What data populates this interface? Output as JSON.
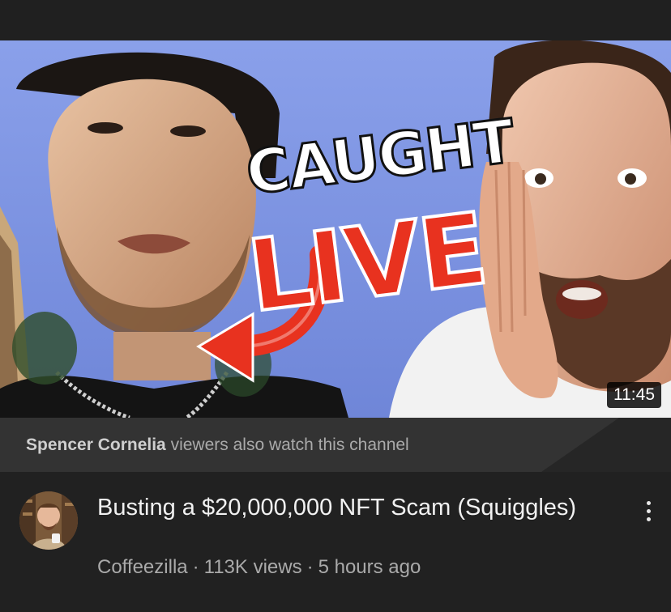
{
  "video": {
    "duration": "11:45",
    "thumbnail_text_top": "CAUGHT",
    "thumbnail_text_bottom": "LIVE",
    "title": "Busting a $20,000,000 NFT Scam (Squiggles)",
    "channel": "Coffeezilla",
    "views": "113K views",
    "age": "5 hours ago",
    "separator": "·"
  },
  "banner": {
    "channel_name": "Spencer Cornelia",
    "text": "viewers also watch this channel"
  },
  "icons": {
    "more": "more-vertical-icon"
  },
  "colors": {
    "background": "#212121",
    "banner": "#333333",
    "live_red": "#e8321f",
    "secondary_text": "#aaaaaa"
  }
}
